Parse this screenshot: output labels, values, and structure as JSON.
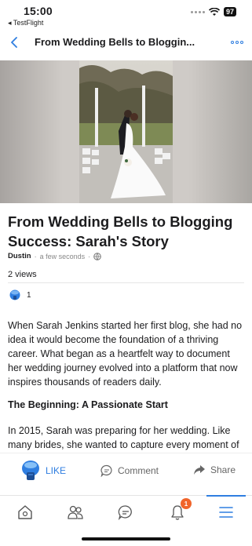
{
  "status": {
    "time": "15:00",
    "back_app": "◂ TestFlight",
    "battery": "97"
  },
  "header": {
    "title": "From Wedding Bells to Bloggin..."
  },
  "post": {
    "title": "From Wedding Bells to Blogging Success: Sarah's Story",
    "author": "Dustin",
    "time": "a few seconds",
    "separator": "·",
    "views": "2 views",
    "reaction_count": "1",
    "paragraph_1": "When Sarah Jenkins started her first blog, she had no idea it would become the foundation of a thriving career. What began as a heartfelt way to document her wedding journey evolved into a platform that now inspires thousands of readers daily.",
    "heading_1": "The Beginning: A Passionate Start",
    "paragraph_2": "In 2015, Sarah was preparing for her wedding. Like many brides, she wanted to capture every moment of"
  },
  "actions": {
    "like": "LIKE",
    "comment": "Comment",
    "share": "Share"
  },
  "tabs": {
    "notification_badge": "1"
  },
  "colors": {
    "accent": "#2f7ee0",
    "badge": "#f0642a"
  }
}
